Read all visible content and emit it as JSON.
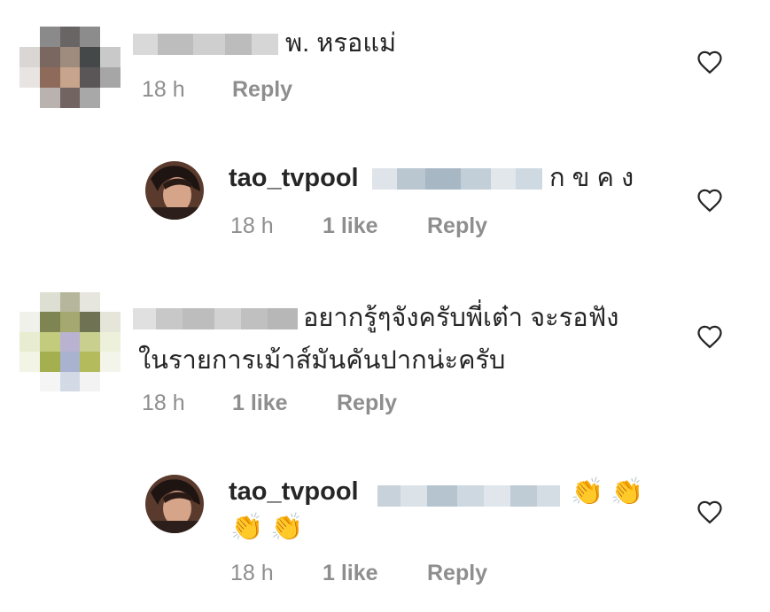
{
  "comments": [
    {
      "text": "พ. หรอแม่",
      "time": "18 h",
      "reply": "Reply"
    },
    {
      "username": "tao_tvpool",
      "text": "ก ข ค ง",
      "time": "18 h",
      "likes": "1 like",
      "reply": "Reply"
    },
    {
      "text_line1": "อยากรู้ๆจังครับพี่เต๋า จะรอฟัง",
      "text_line2": "ในรายการเม้าส์มันคันปากน่ะครับ",
      "time": "18 h",
      "likes": "1 like",
      "reply": "Reply"
    },
    {
      "username": "tao_tvpool",
      "emoji": [
        "👏",
        "👏",
        "👏",
        "👏"
      ],
      "time": "18 h",
      "likes": "1 like",
      "reply": "Reply"
    }
  ],
  "icons": {
    "like": "heart-outline-icon",
    "clap": "clapping-hands-emoji"
  },
  "colors": {
    "text": "#262626",
    "meta": "#8e8e8e",
    "emoji": "#f5c518"
  }
}
